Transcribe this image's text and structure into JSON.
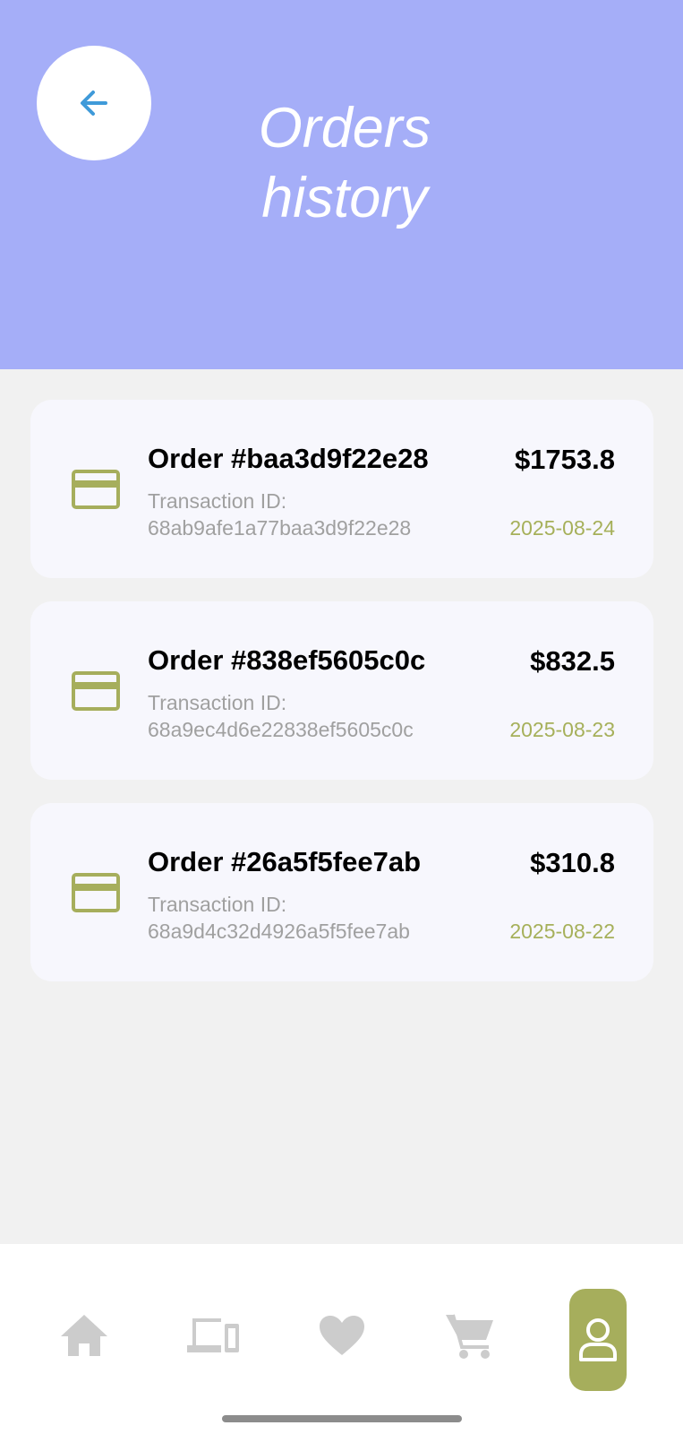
{
  "header": {
    "title": "Orders history",
    "back_icon": "arrow-left-icon",
    "background_color": "#a5aef8"
  },
  "orders": [
    {
      "title": "Order #baa3d9f22e28",
      "transaction_label": "Transaction ID:",
      "transaction_id": "68ab9afe1a77baa3d9f22e28",
      "price": "$1753.8",
      "date": "2025-08-24",
      "icon": "credit-card-icon"
    },
    {
      "title": "Order #838ef5605c0c",
      "transaction_label": "Transaction ID:",
      "transaction_id": "68a9ec4d6e22838ef5605c0c",
      "price": "$832.5",
      "date": "2025-08-23",
      "icon": "credit-card-icon"
    },
    {
      "title": "Order #26a5f5fee7ab",
      "transaction_label": "Transaction ID:",
      "transaction_id": "68a9d4c32d4926a5f5fee7ab",
      "price": "$310.8",
      "date": "2025-08-22",
      "icon": "credit-card-icon"
    }
  ],
  "nav": {
    "items": [
      "home-icon",
      "devices-icon",
      "heart-icon",
      "cart-icon",
      "profile-icon"
    ],
    "active": "profile-icon",
    "active_color": "#a6ae5c",
    "inactive_color": "#cccccc"
  },
  "colors": {
    "accent": "#a6ae5c",
    "date": "#a6b05a",
    "back_arrow": "#3f9ad9"
  }
}
